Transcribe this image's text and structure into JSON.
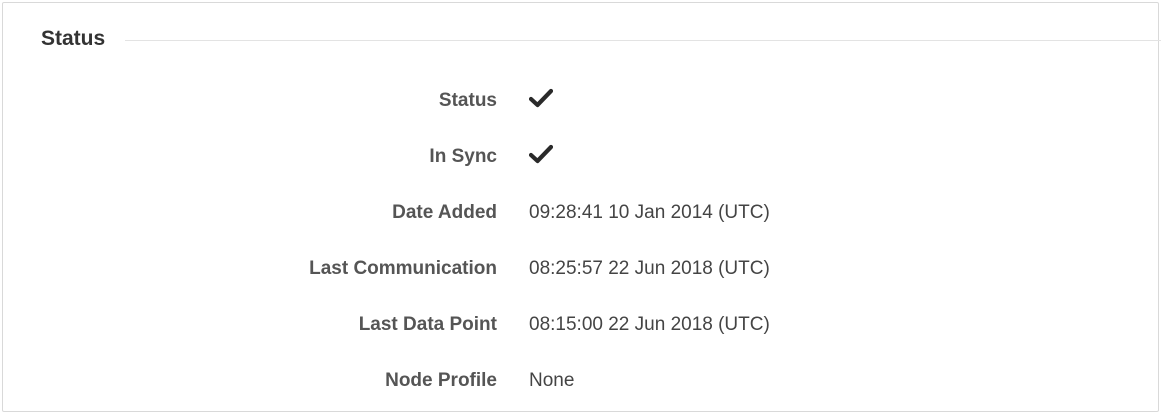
{
  "section": {
    "title": "Status"
  },
  "rows": [
    {
      "label": "Status",
      "value": "",
      "icon": "check-icon"
    },
    {
      "label": "In Sync",
      "value": "",
      "icon": "check-icon"
    },
    {
      "label": "Date Added",
      "value": "09:28:41 10 Jan 2014 (UTC)"
    },
    {
      "label": "Last Communication",
      "value": "08:25:57 22 Jun 2018 (UTC)"
    },
    {
      "label": "Last Data Point",
      "value": "08:15:00 22 Jun 2018 (UTC)"
    },
    {
      "label": "Node Profile",
      "value": "None"
    }
  ]
}
